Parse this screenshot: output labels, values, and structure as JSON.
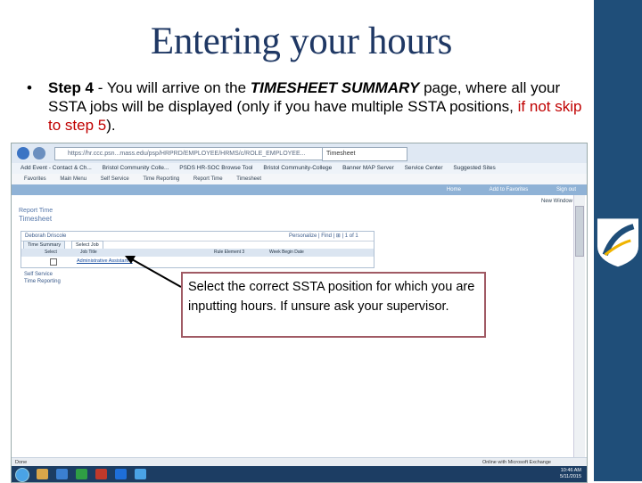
{
  "slide": {
    "title": "Entering your hours",
    "bullet": {
      "step_label": "Step 4",
      "text_before": " - You will arrive on the ",
      "emphasis": "TIMESHEET SUMMARY",
      "text_after": " page, where all your SSTA jobs will be displayed (only if you have multiple SSTA positions, ",
      "red_text": "if not skip to step 5",
      "end": ")."
    },
    "callout": "Select the correct SSTA position for which you are inputting hours.  If unsure ask your supervisor."
  },
  "browser": {
    "url": "https://hr.ccc.psn...mass.edu/psp/HRPRD/EMPLOYEE/HRMS/c/ROLE_EMPLOYEE...",
    "tab_title": "Timesheet",
    "favorites": [
      "Add Event - Contact & Ch...",
      "Bristol Community Colle...",
      "PSDS HR-SOC Browse Tool",
      "Bristol Community-College",
      "Banner MAP Server",
      "Service Center",
      "Suggested Sites"
    ],
    "menu": [
      "Favorites",
      "Main Menu",
      "Self Service",
      "Time Reporting",
      "Report Time",
      "Timesheet"
    ],
    "header_links": [
      "Home",
      "Add to Favorites",
      "Sign out"
    ],
    "new_window": "New Window",
    "page_title_small": "Report Time",
    "page_title": "Timesheet",
    "grid": {
      "owner": "Deborah Driscole",
      "controls": "Personalize | Find | ⊞ | 1 of 1",
      "tabs": [
        "Time Summary",
        "Select Job"
      ],
      "columns": [
        "Select",
        "Job Title",
        "Rule Element 3",
        "Week Begin Date"
      ],
      "row_job": "Administrative Assistant II"
    },
    "side_nav": [
      "Self Service",
      "Time Reporting"
    ],
    "status_left": "Done",
    "status_right": "Online with Microsoft Exchange",
    "clock_time": "10:46 AM",
    "clock_date": "5/11/2015"
  },
  "colors": {
    "title": "#1f3864",
    "right_bar": "#1f4e79",
    "red_text": "#c00000",
    "callout_border": "#a05a64"
  }
}
